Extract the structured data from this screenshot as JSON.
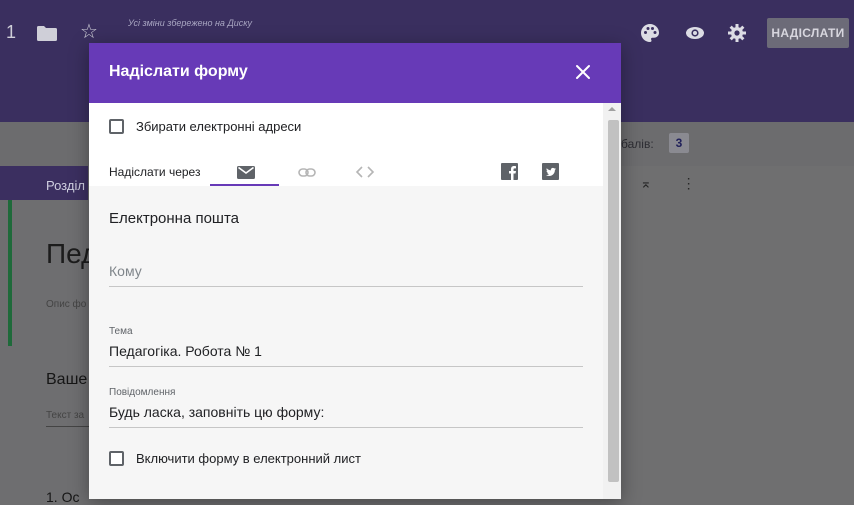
{
  "app": {
    "header_number": "1",
    "saved_status": "Усі зміни збережено на Диску",
    "send_button": "НАДІСЛАТИ",
    "points_label": "балів:",
    "points_value": "3",
    "section_label": "Розділ",
    "form_title_partial": "Пед",
    "form_desc_partial": "Опис фо",
    "question_title_partial": "Ваше",
    "question_text_partial": "Текст за",
    "first_item_partial": "1. Ос",
    "icons": [
      "folder-icon",
      "star-icon",
      "palette-icon",
      "eye-icon",
      "gear-icon"
    ]
  },
  "dialog": {
    "title": "Надіслати форму",
    "collect_emails_label": "Збирати електронні адреси",
    "send_via_label": "Надіслати через",
    "tabs": [
      "email-icon",
      "link-icon",
      "embed-icon"
    ],
    "share_icons": [
      "facebook-icon",
      "twitter-icon"
    ],
    "email_section_title": "Електронна пошта",
    "to_placeholder": "Кому",
    "subject_label": "Тема",
    "subject_value": "Педагогіка. Робота № 1",
    "message_label": "Повідомлення",
    "message_value": "Будь ласка, заповніть цю форму:",
    "include_form_label": "Включити форму в електронний лист"
  },
  "colors": {
    "accent": "#673ab7",
    "header_dimmed": "#3a2f5f"
  }
}
